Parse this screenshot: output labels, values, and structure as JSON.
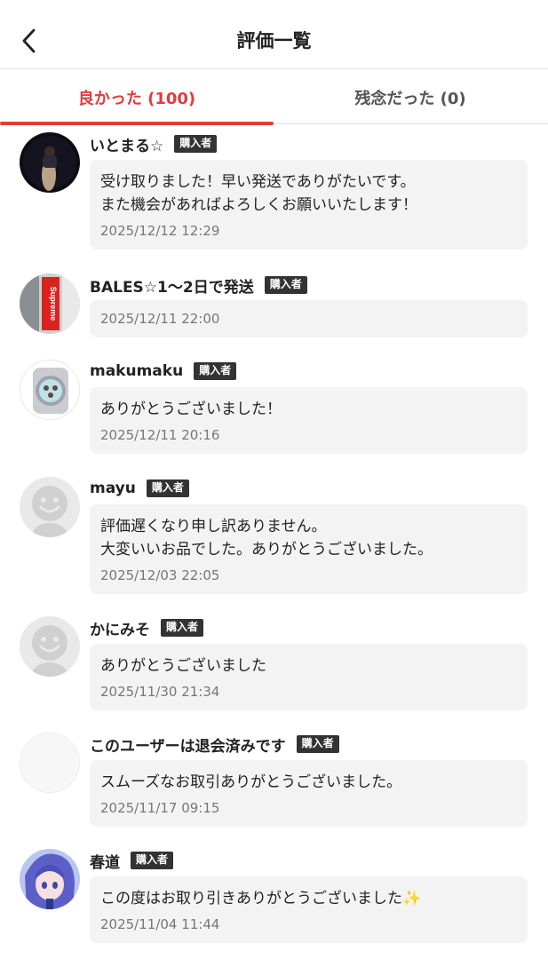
{
  "header": {
    "title": "評価一覧"
  },
  "tabs": {
    "good": "良かった (100)",
    "bad": "残念だった (0)"
  },
  "reviews": [
    {
      "name": "いとまる☆",
      "badge": "購入者",
      "comment": "受け取りました！早い発送でありがたいです。\nまた機会があればよろしくお願いいたします！",
      "date": "2025/12/12 12:29"
    },
    {
      "name": "BALES☆1〜2日で発送",
      "badge": "購入者",
      "comment": "",
      "date": "2025/12/11 22:00"
    },
    {
      "name": "makumaku",
      "badge": "購入者",
      "comment": "ありがとうございました！",
      "date": "2025/12/11 20:16"
    },
    {
      "name": "mayu",
      "badge": "購入者",
      "comment": "評価遅くなり申し訳ありません。\n大変いいお品でした。ありがとうございました。",
      "date": "2025/12/03 22:05"
    },
    {
      "name": "かにみそ",
      "badge": "購入者",
      "comment": "ありがとうございました",
      "date": "2025/11/30 21:34"
    },
    {
      "name": "このユーザーは退会済みです",
      "badge": "購入者",
      "comment": "スムーズなお取引ありがとうございました。",
      "date": "2025/11/17 09:15"
    },
    {
      "name": "春道",
      "badge": "購入者",
      "comment": "この度はお取り引きありがとうございました✨",
      "date": "2025/11/04 11:44"
    }
  ],
  "avatar_logo_text": "Supreme",
  "colors": {
    "accent": "#e23b3b",
    "badge_bg": "#333333",
    "bubble_bg": "#f3f3f3"
  }
}
